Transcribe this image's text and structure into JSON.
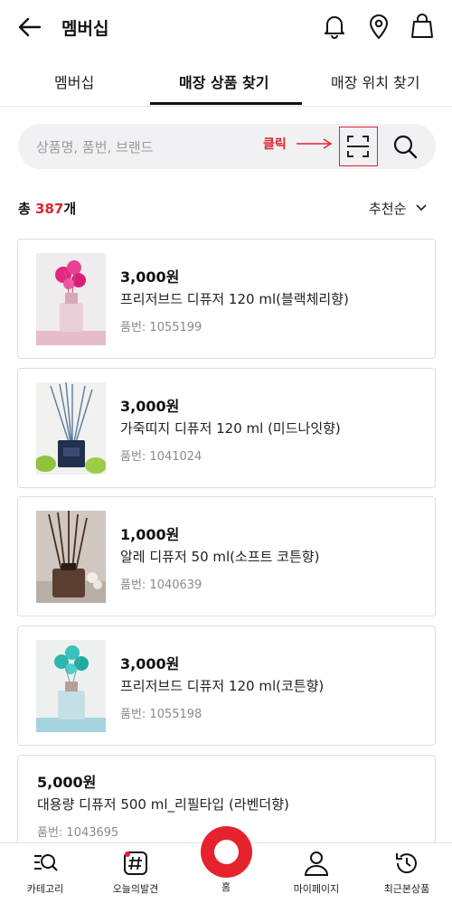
{
  "header": {
    "title": "멤버십",
    "icons": [
      "back-arrow-icon",
      "bell-icon",
      "location-pin-icon",
      "shopping-bag-icon"
    ]
  },
  "tabs": [
    {
      "label": "멤버십",
      "active": false
    },
    {
      "label": "매장 상품 찾기",
      "active": true
    },
    {
      "label": "매장 위치 찾기",
      "active": false
    }
  ],
  "search": {
    "placeholder": "상품명, 품번, 브랜드",
    "annotation": "클릭",
    "scan_icon": "barcode-scan-icon",
    "search_icon": "search-icon"
  },
  "results": {
    "prefix": "총 ",
    "count": "387",
    "suffix": "개",
    "sort_label": "추천순"
  },
  "products": [
    {
      "price": "3,000원",
      "name": "프리저브드 디퓨저 120 ml(블랙체리향)",
      "number": "품번: 1055199",
      "image": "pink-flower-diffuser"
    },
    {
      "price": "3,000원",
      "name": "가죽띠지 디퓨저 120 ml (미드나잇향)",
      "number": "품번: 1041024",
      "image": "navy-reed-diffuser"
    },
    {
      "price": "1,000원",
      "name": "알레 디퓨저 50 ml(소프트 코튼향)",
      "number": "품번: 1040639",
      "image": "brown-reed-diffuser"
    },
    {
      "price": "3,000원",
      "name": "프리저브드 디퓨저 120 ml(코튼향)",
      "number": "품번: 1055198",
      "image": "teal-flower-diffuser"
    },
    {
      "price": "5,000원",
      "name": "대용량 디퓨저 500 ml_리필타입 (라벤더향)",
      "number": "품번: 1043695",
      "image": ""
    }
  ],
  "bottom_nav": [
    {
      "label": "카테고리",
      "icon": "category-search-icon"
    },
    {
      "label": "오늘의발견",
      "icon": "hashtag-icon"
    },
    {
      "label": "홈",
      "icon": "home-circle-icon"
    },
    {
      "label": "마이페이지",
      "icon": "person-icon"
    },
    {
      "label": "최근본상품",
      "icon": "history-icon"
    }
  ],
  "colors": {
    "accent": "#e0242f",
    "home": "#e5222e"
  }
}
